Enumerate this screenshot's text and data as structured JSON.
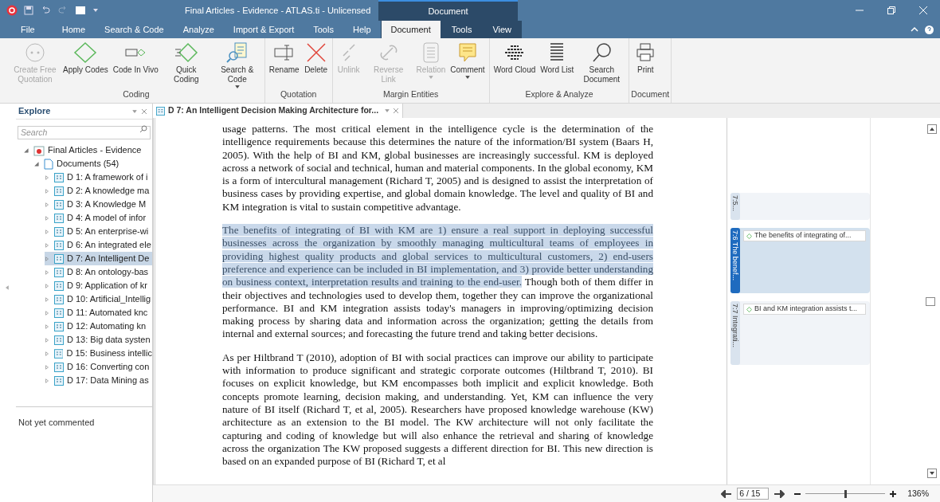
{
  "window": {
    "title": "Final Articles - Evidence - ATLAS.ti - Unlicensed",
    "context_header": "Document"
  },
  "menu_tabs": [
    {
      "label": "File",
      "selected": false,
      "contextual": false
    },
    {
      "label": "Home",
      "selected": false,
      "contextual": false
    },
    {
      "label": "Search & Code",
      "selected": false,
      "contextual": false
    },
    {
      "label": "Analyze",
      "selected": false,
      "contextual": false
    },
    {
      "label": "Import & Export",
      "selected": false,
      "contextual": false
    },
    {
      "label": "Tools",
      "selected": false,
      "contextual": false
    },
    {
      "label": "Help",
      "selected": false,
      "contextual": false
    },
    {
      "label": "Document",
      "selected": true,
      "contextual": true
    },
    {
      "label": "Tools",
      "selected": false,
      "contextual": true
    },
    {
      "label": "View",
      "selected": false,
      "contextual": true
    }
  ],
  "ribbon_groups": [
    {
      "label": "Coding",
      "buttons": [
        {
          "label": "Create Free Quotation",
          "disabled": true,
          "dropdown": false
        },
        {
          "label": "Apply Codes",
          "disabled": false,
          "dropdown": false
        },
        {
          "label": "Code In Vivo",
          "disabled": false,
          "dropdown": false
        },
        {
          "label": "Quick Coding",
          "disabled": false,
          "dropdown": false
        },
        {
          "label": "Search & Code",
          "disabled": false,
          "dropdown": true
        }
      ]
    },
    {
      "label": "Quotation",
      "buttons": [
        {
          "label": "Rename",
          "disabled": false,
          "dropdown": false
        },
        {
          "label": "Delete",
          "disabled": false,
          "dropdown": false
        }
      ]
    },
    {
      "label": "Margin Entities",
      "buttons": [
        {
          "label": "Unlink",
          "disabled": true,
          "dropdown": false
        },
        {
          "label": "Reverse Link",
          "disabled": true,
          "dropdown": false
        },
        {
          "label": "Relation",
          "disabled": true,
          "dropdown": true
        },
        {
          "label": "Comment",
          "disabled": false,
          "dropdown": true
        }
      ]
    },
    {
      "label": "Explore & Analyze",
      "buttons": [
        {
          "label": "Word Cloud",
          "disabled": false,
          "dropdown": false
        },
        {
          "label": "Word List",
          "disabled": false,
          "dropdown": false
        },
        {
          "label": "Search Document",
          "disabled": false,
          "dropdown": false
        }
      ]
    },
    {
      "label": "Document",
      "buttons": [
        {
          "label": "Print",
          "disabled": false,
          "dropdown": false
        }
      ]
    }
  ],
  "explore": {
    "title": "Explore",
    "search_placeholder": "Search",
    "tree": [
      {
        "label": "Final Articles - Evidence",
        "kind": "project",
        "expanded": true,
        "selected": false,
        "children": [
          {
            "label": "Documents (54)",
            "kind": "group",
            "expanded": true,
            "selected": false,
            "children": [
              {
                "label": "D 1: A framework of i",
                "kind": "doc",
                "expanded": false,
                "selected": false
              },
              {
                "label": "D 2: A knowledge ma",
                "kind": "doc",
                "expanded": false,
                "selected": false
              },
              {
                "label": "D 3: A Knowledge M",
                "kind": "doc",
                "expanded": false,
                "selected": false
              },
              {
                "label": "D 4: A model of infor",
                "kind": "doc",
                "expanded": false,
                "selected": false
              },
              {
                "label": "D 5: An enterprise-wi",
                "kind": "doc",
                "expanded": false,
                "selected": false
              },
              {
                "label": "D 6: An integrated ele",
                "kind": "doc",
                "expanded": false,
                "selected": false
              },
              {
                "label": "D 7: An Intelligent De",
                "kind": "doc",
                "expanded": false,
                "selected": true
              },
              {
                "label": "D 8: An ontology-bas",
                "kind": "doc",
                "expanded": false,
                "selected": false
              },
              {
                "label": "D 9: Application of kr",
                "kind": "doc",
                "expanded": false,
                "selected": false
              },
              {
                "label": "D 10: Artificial_Intellig",
                "kind": "doc",
                "expanded": false,
                "selected": false
              },
              {
                "label": "D 11: Automated knc",
                "kind": "doc",
                "expanded": false,
                "selected": false
              },
              {
                "label": "D 12: Automating kn",
                "kind": "doc",
                "expanded": false,
                "selected": false
              },
              {
                "label": "D 13: Big data systen",
                "kind": "doc",
                "expanded": false,
                "selected": false
              },
              {
                "label": "D 15: Business intellic",
                "kind": "doc",
                "expanded": false,
                "selected": false
              },
              {
                "label": "D 16: Converting con",
                "kind": "doc",
                "expanded": false,
                "selected": false
              },
              {
                "label": "D 17: Data Mining as",
                "kind": "doc",
                "expanded": false,
                "selected": false
              }
            ]
          }
        ]
      }
    ],
    "comment": "Not yet commented"
  },
  "document_tab": {
    "label": "D 7: An Intelligent Decision Making Architecture for..."
  },
  "paragraphs": [
    {
      "segments": [
        {
          "text": "usage patterns. The most critical element in the intelligence cycle is the determination of the intelligence requirements because this determines the nature of the information/BI system (Baars H, 2005). With the help of BI and KM, global businesses are increasingly successful. KM is deployed across a network of social and technical, human and material components. In the global economy, KM is a form of intercultural management (Richard T, 2005) and is designed to assist the interpretation of business cases by providing expertise, and global domain knowledge. The level and quality of BI and KM integration is vital to sustain competitive advantage.",
          "highlighted": false
        }
      ]
    },
    {
      "segments": [
        {
          "text": "The benefits of integrating of BI with KM are 1) ensure a real support in deploying successful businesses across the organization by smoothly managing multicultural teams of employees in providing highest quality products and global services to multicultural customers, 2) end-users preference and experience can be included in BI implementation, and 3) provide better understanding on business context, interpretation results and training to the end-user.",
          "highlighted": true
        },
        {
          "text": " Though both of them differ in their objectives and technologies used to develop them, together they can improve the organizational performance. BI and KM integration assists today's managers in improving/optimizing decision making process by sharing data and information across the organization; getting the details from internal and external sources; and forecasting the future trend and taking better decisions.",
          "highlighted": false
        }
      ]
    },
    {
      "segments": [
        {
          "text": "As per Hiltbrand T (2010), adoption of BI with social practices can improve our ability to participate with information to produce significant and strategic corporate outcomes (Hiltbrand T, 2010). BI focuses on explicit knowledge, but KM encompasses both implicit and explicit knowledge. Both concepts promote learning, decision making, and understanding. Yet, KM can influence the very nature of BI itself (Richard T, et al, 2005). Researchers have proposed knowledge warehouse (KW) architecture as an extension to the BI model. The KW architecture will not only facilitate the capturing and coding of knowledge but will also enhance the retrieval and sharing of knowledge across the organization The KW proposed suggests a different direction for BI. This new direction is based on an expanded purpose of BI (Richard T, et al",
          "highlighted": false
        }
      ]
    }
  ],
  "quotations": [
    {
      "label": "7:5...",
      "selected": false
    },
    {
      "label": "7:6 The benef...",
      "selected": true,
      "code": "The benefits of integrating of..."
    },
    {
      "label": "7:7 Integrati...",
      "selected": false,
      "code": "BI and KM integration assists t..."
    }
  ],
  "status_bar": {
    "page": "6 / 15",
    "level": 0.5,
    "zoom": "136%"
  }
}
